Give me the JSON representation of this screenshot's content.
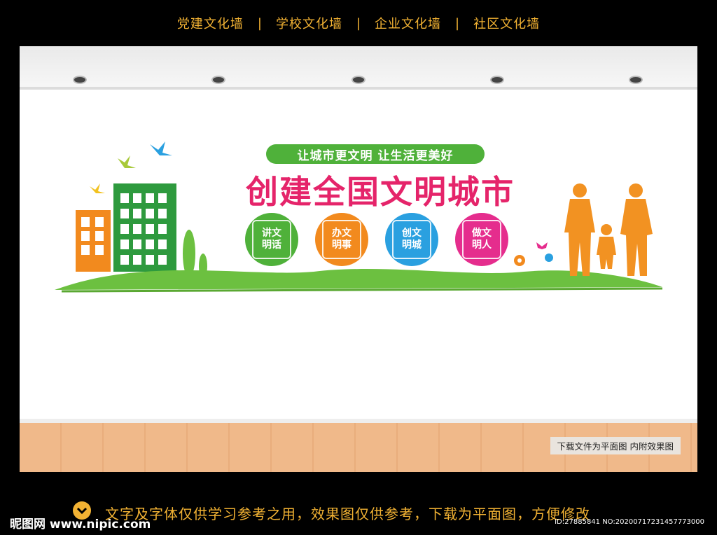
{
  "nav": {
    "items": [
      "党建文化墙",
      "学校文化墙",
      "企业文化墙",
      "社区文化墙"
    ],
    "separator": "|"
  },
  "banner": {
    "slogan": "让城市更文明  让生活更美好",
    "title": "创建全国文明城市",
    "circles": [
      {
        "line1": "讲文",
        "line2": "明话",
        "color": "#4fb13a"
      },
      {
        "line1": "办文",
        "line2": "明事",
        "color": "#f28a1e"
      },
      {
        "line1": "创文",
        "line2": "明城",
        "color": "#2aa0e0"
      },
      {
        "line1": "做文",
        "line2": "明人",
        "color": "#e52d8d"
      }
    ]
  },
  "room": {
    "caption": "下载文件为平面图  内附效果图"
  },
  "footer": {
    "logo": "昵图网 www.nipic.com",
    "notice": "文字及字体仅供学习参考之用，效果图仅供参考，下载为平面图，方便修改",
    "id": "ID:27885841 NO:20200717231457773000"
  },
  "colors": {
    "accent": "#f2b233",
    "title": "#e5246a",
    "green": "#4fb13a",
    "silhouette": "#f29222"
  }
}
